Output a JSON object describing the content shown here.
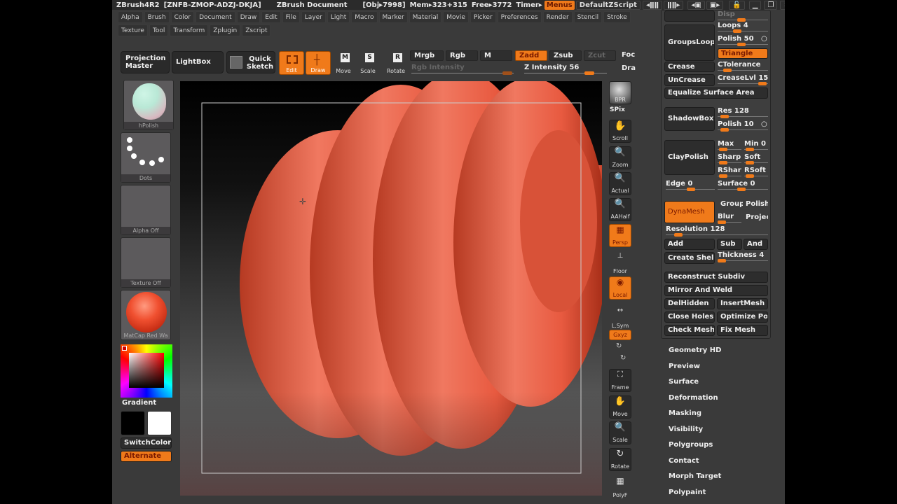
{
  "titlebar": {
    "app": "ZBrush4R2",
    "serial": "[ZNFB-ZMOP-ADZJ-DKJA]",
    "document": "ZBrush Document",
    "obj": "[Obj▸7998]",
    "mem": "Mem▸323+315",
    "free": "Free▸3772",
    "timer": "Timer▸",
    "menus_btn": "Menus",
    "script_btn": "DefaultZScript"
  },
  "menubar": {
    "row1": [
      "Alpha",
      "Brush",
      "Color",
      "Document",
      "Draw",
      "Edit",
      "File",
      "Layer",
      "Light",
      "Macro",
      "Marker",
      "Material",
      "Movie",
      "Picker",
      "Preferences",
      "Render",
      "Stencil",
      "Stroke"
    ],
    "row2": [
      "Texture",
      "Tool",
      "Transform",
      "Zplugin",
      "Zscript"
    ]
  },
  "toolbar": {
    "projection_master": "Projection Master",
    "lightbox": "LightBox",
    "quick_sketch": "Quick Sketch",
    "edit": "Edit",
    "draw": "Draw",
    "move": "Move",
    "scale": "Scale",
    "rotate": "Rotate",
    "mrgb": "Mrgb",
    "rgb": "Rgb",
    "m": "M",
    "zadd": "Zadd",
    "zsub": "Zsub",
    "zcut": "Zcut",
    "rgb_intensity": "Rgb Intensity",
    "z_intensity": "Z Intensity 56",
    "z_intensity_value": 56,
    "focal": "Foc",
    "draw_size": "Dra"
  },
  "left_panel": {
    "brush": "hPolish",
    "stroke": "Dots",
    "alpha": "Alpha Off",
    "texture": "Texture Off",
    "material": "MatCap Red Wa",
    "gradient": "Gradient",
    "switch_color": "SwitchColor",
    "alternate": "Alternate",
    "main_color": "#000000",
    "secondary_color": "#ffffff"
  },
  "shelf": {
    "bpr": "BPR",
    "spix": "SPix",
    "scroll": "Scroll",
    "zoom": "Zoom",
    "actual": "Actual",
    "aahalf": "AAHalf",
    "persp": "Persp",
    "floor": "Floor",
    "local": "Local",
    "lsym": "L.Sym",
    "xyz": "Gxyz",
    "frame": "Frame",
    "move": "Move",
    "scale": "Scale",
    "rotate": "Rotate",
    "polyf": "PolyF"
  },
  "geometry": {
    "disp": "Disp",
    "groups_loops": "GroupsLoops",
    "loops": "Loops 4",
    "polish50": "Polish 50",
    "triangle": "Triangle",
    "crease": "Crease",
    "ctolerance": "CTolerance",
    "uncrease": "UnCrease",
    "creaselvl": "CreaseLvl 15",
    "equalize": "Equalize Surface Area",
    "shadowbox": "ShadowBox",
    "res": "Res 128",
    "polish10": "Polish 10",
    "claypolish": "ClayPolish",
    "max": "Max",
    "min": "Min 0",
    "sharp": "Sharp",
    "soft": "Soft",
    "rsharp": "RShar",
    "rsoft": "RSoft",
    "edge": "Edge 0",
    "surface": "Surface 0",
    "dynamesh": "DynaMesh",
    "group": "Group",
    "polish": "Polish",
    "blur": "Blur",
    "project": "Projec",
    "resolution": "Resolution 128",
    "add": "Add",
    "sub": "Sub",
    "and": "And",
    "create_shell": "Create Shell",
    "thickness": "Thickness 4",
    "reconstruct": "Reconstruct Subdiv",
    "mirror_weld": "Mirror And Weld",
    "delhidden": "DelHidden",
    "insertmesh": "InsertMesh",
    "close_holes": "Close Holes",
    "optimize": "Optimize Poi",
    "check_mesh": "Check Mesh",
    "fix_mesh": "Fix Mesh"
  },
  "tool_subpalettes": [
    "Geometry HD",
    "Preview",
    "Surface",
    "Deformation",
    "Masking",
    "Visibility",
    "Polygroups",
    "Contact",
    "Morph Target",
    "Polypaint"
  ]
}
